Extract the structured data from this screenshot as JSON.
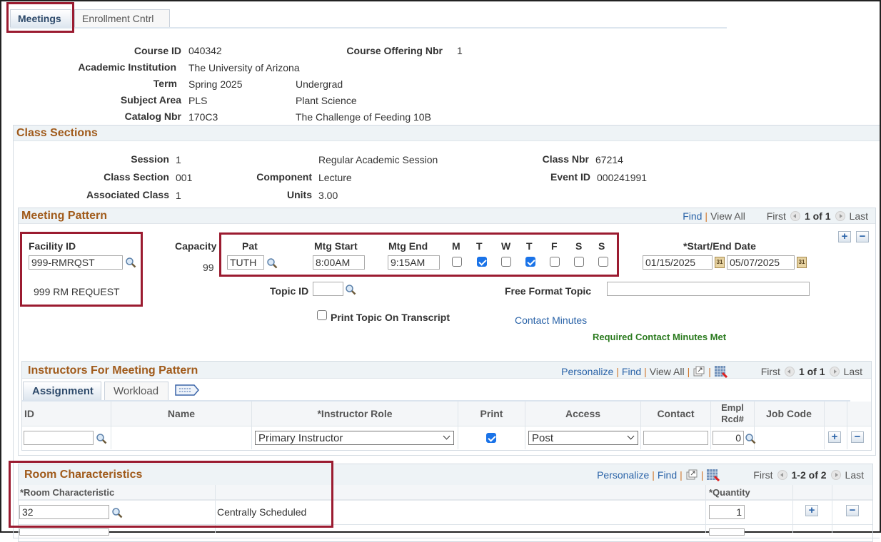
{
  "tabs": [
    {
      "label": "Meetings",
      "active": true
    },
    {
      "label": "Enrollment Cntrl",
      "active": false
    }
  ],
  "course": {
    "course_id_label": "Course ID",
    "course_id": "040342",
    "offering_label": "Course Offering Nbr",
    "offering": "1",
    "institution_label": "Academic Institution",
    "institution": "The University of Arizona",
    "term_label": "Term",
    "term": "Spring 2025",
    "career": "Undergrad",
    "subject_label": "Subject Area",
    "subject": "PLS",
    "subject_desc": "Plant Science",
    "catalog_label": "Catalog Nbr",
    "catalog": "170C3",
    "catalog_desc": "The Challenge of Feeding 10B"
  },
  "class_sections": {
    "title": "Class Sections",
    "session_label": "Session",
    "session": "1",
    "session_desc": "Regular Academic Session",
    "class_nbr_label": "Class Nbr",
    "class_nbr": "67214",
    "section_label": "Class Section",
    "section": "001",
    "component_label": "Component",
    "component": "Lecture",
    "event_label": "Event ID",
    "event": "000241991",
    "assoc_label": "Associated Class",
    "assoc": "1",
    "units_label": "Units",
    "units": "3.00"
  },
  "meeting_pattern": {
    "title": "Meeting Pattern",
    "nav": {
      "find": "Find",
      "view_all": "View All",
      "first": "First",
      "count": "1 of 1",
      "last": "Last"
    },
    "facility_label": "Facility ID",
    "facility": "999-RMRQST",
    "facility_desc": "999  RM REQUEST",
    "capacity_label": "Capacity",
    "capacity": "99",
    "pat_label": "Pat",
    "pat": "TUTH",
    "start_label": "Mtg Start",
    "start": "8:00AM",
    "end_label": "Mtg End",
    "end": "9:15AM",
    "days": [
      {
        "label": "M",
        "checked": false
      },
      {
        "label": "T",
        "checked": true
      },
      {
        "label": "W",
        "checked": false
      },
      {
        "label": "T",
        "checked": true
      },
      {
        "label": "F",
        "checked": false
      },
      {
        "label": "S",
        "checked": false
      },
      {
        "label": "S",
        "checked": false
      }
    ],
    "date_label": "*Start/End Date",
    "start_date": "01/15/2025",
    "end_date": "05/07/2025",
    "topic_label": "Topic ID",
    "topic": "",
    "free_topic_label": "Free Format Topic",
    "free_topic": "",
    "print_topic_label": "Print Topic On Transcript",
    "print_topic": false,
    "contact_minutes_link": "Contact Minutes",
    "contact_status": "Required Contact Minutes Met",
    "add_icon": "+",
    "remove_icon": "−",
    "calendar_glyph": "31"
  },
  "instructors": {
    "title": "Instructors For Meeting Pattern",
    "nav": {
      "personalize": "Personalize",
      "find": "Find",
      "view_all": "View All",
      "first": "First",
      "count": "1 of 1",
      "last": "Last"
    },
    "subtabs": [
      {
        "label": "Assignment",
        "active": true
      },
      {
        "label": "Workload",
        "active": false
      }
    ],
    "columns": [
      "ID",
      "Name",
      "*Instructor Role",
      "Print",
      "Access",
      "Contact",
      "Empl Rcd#",
      "Job Code"
    ],
    "rows": [
      {
        "id": "",
        "name": "",
        "role": "Primary Instructor",
        "print": true,
        "access": "Post",
        "contact": "",
        "empl_rcd": "0",
        "job_code": ""
      }
    ]
  },
  "room_characteristics": {
    "title": "Room Characteristics",
    "nav": {
      "personalize": "Personalize",
      "find": "Find",
      "first": "First",
      "count": "1-2 of 2",
      "last": "Last"
    },
    "columns": [
      "*Room Characteristic",
      "",
      "*Quantity"
    ],
    "rows": [
      {
        "characteristic": "32",
        "description": "Centrally Scheduled",
        "quantity": "1"
      }
    ]
  }
}
